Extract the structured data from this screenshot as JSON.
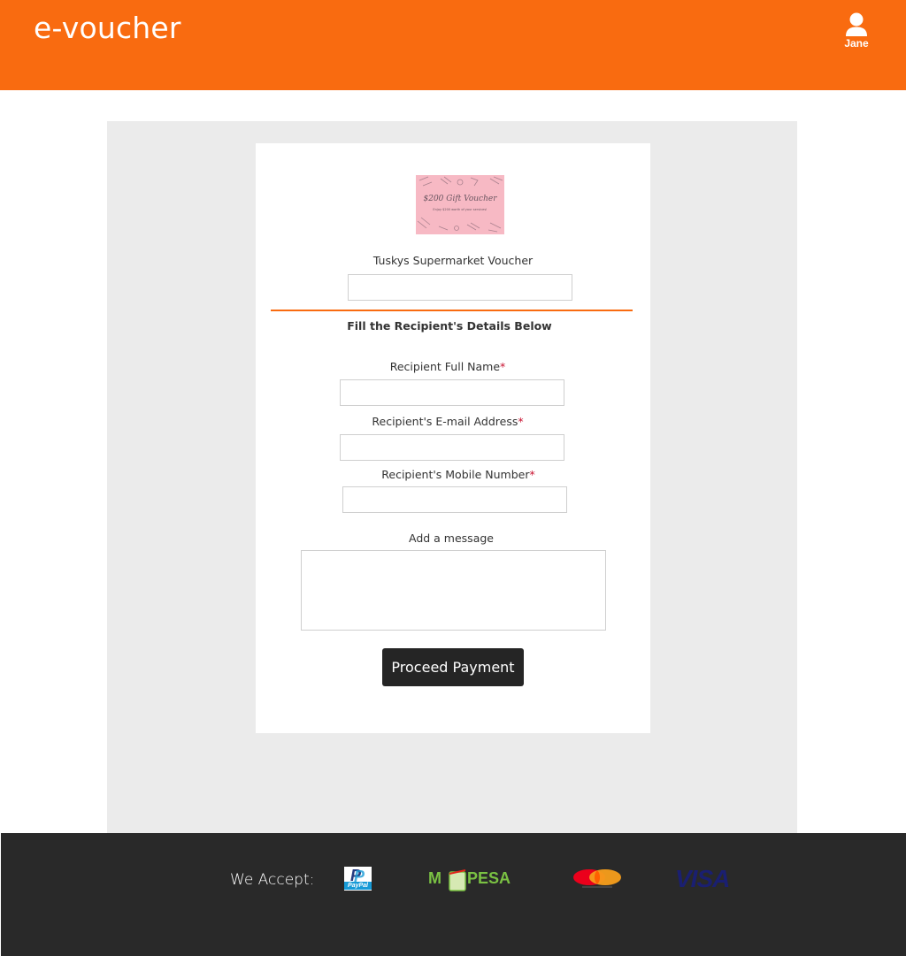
{
  "header": {
    "brand": "e-voucher",
    "user_name": "Jane"
  },
  "voucher": {
    "image_title": "$200 Gift Voucher",
    "image_subtitle": "Enjoy $200 worth of your services!",
    "name": "Tuskys Supermarket Voucher",
    "value_input": ""
  },
  "form": {
    "section_title": "Fill the Recipient's Details Below",
    "full_name_label": "Recipient Full Name",
    "email_label": "Recipient's E-mail Address",
    "mobile_label": "Recipient's Mobile Number",
    "required_marker": "*",
    "message_label": "Add a message",
    "full_name_value": "",
    "email_value": "",
    "mobile_value": "",
    "message_value": "",
    "submit_label": "Proceed Payment"
  },
  "footer": {
    "accept_label": "We Accept:",
    "paypal_text": "PayPal",
    "mpesa_text": "M-PESA",
    "visa_text": "VISA"
  },
  "colors": {
    "brand_orange": "#f96b10",
    "panel_gray": "#ebebeb",
    "footer_dark": "#292929",
    "button_dark": "#252525",
    "required_red": "#c8102e"
  }
}
